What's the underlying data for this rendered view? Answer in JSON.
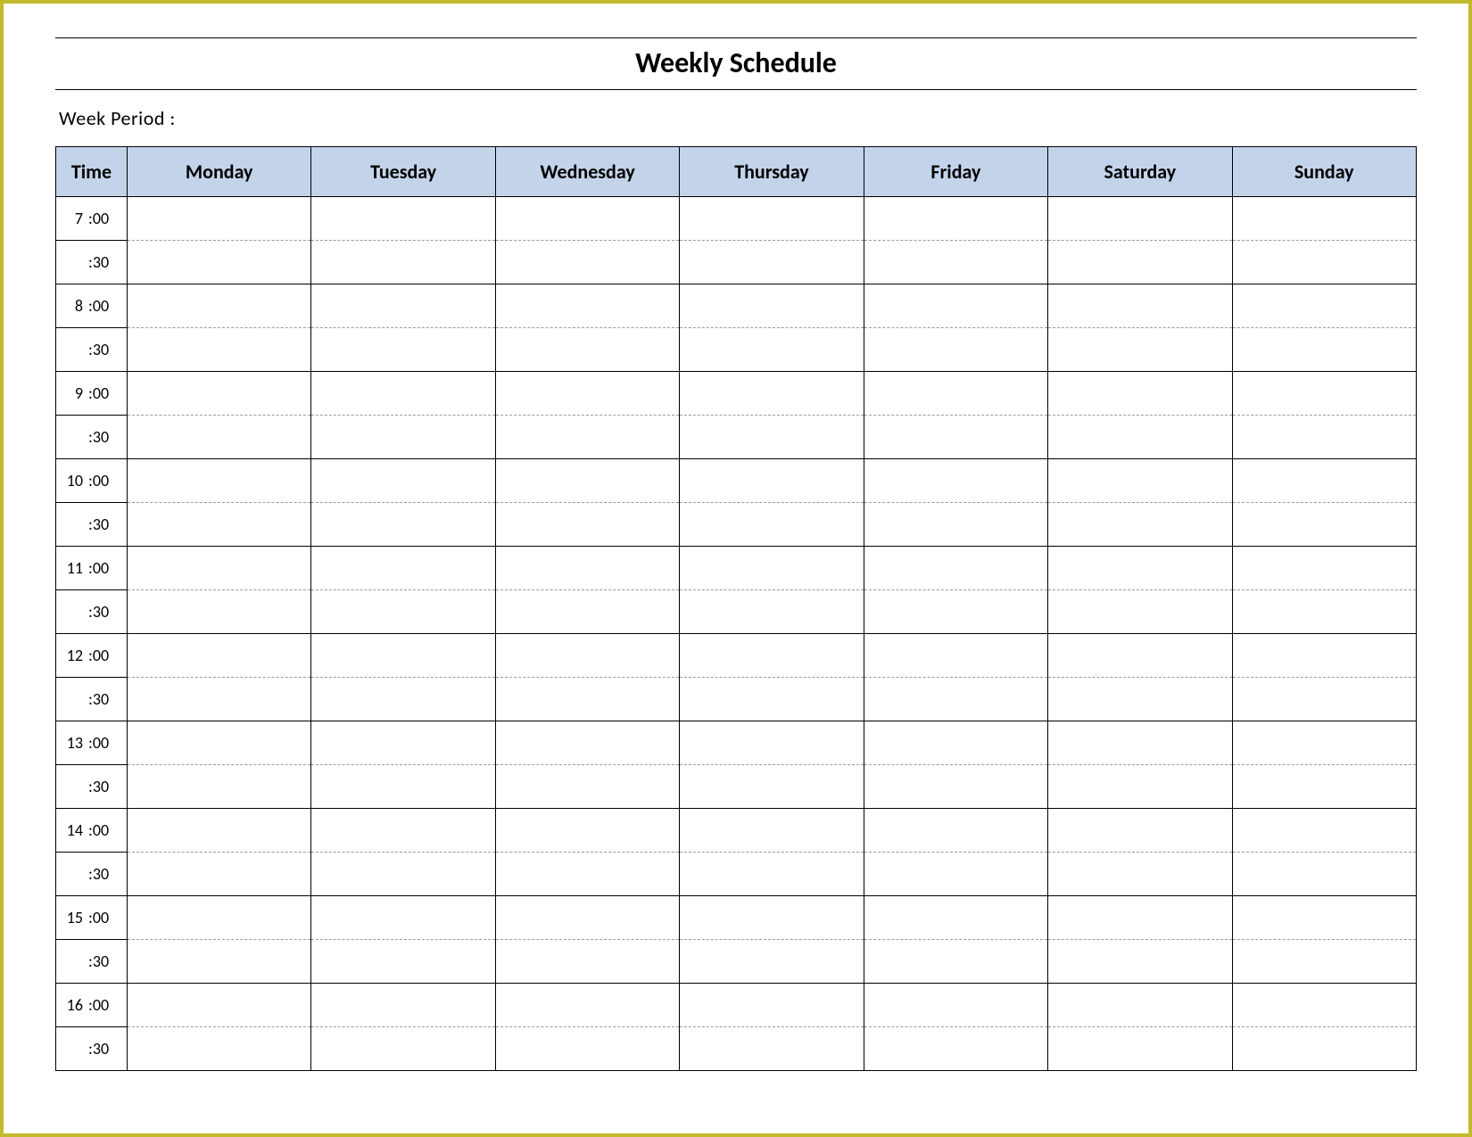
{
  "title": "Weekly Schedule",
  "week_period_label": "Week  Period :",
  "headers": [
    "Time",
    "Monday",
    "Tuesday",
    "Wednesday",
    "Thursday",
    "Friday",
    "Saturday",
    "Sunday"
  ],
  "time_rows": [
    {
      "hour": "7",
      "minute": ":00"
    },
    {
      "hour": "",
      "minute": ":30"
    },
    {
      "hour": "8",
      "minute": ":00"
    },
    {
      "hour": "",
      "minute": ":30"
    },
    {
      "hour": "9",
      "minute": ":00"
    },
    {
      "hour": "",
      "minute": ":30"
    },
    {
      "hour": "10",
      "minute": ":00"
    },
    {
      "hour": "",
      "minute": ":30"
    },
    {
      "hour": "11",
      "minute": ":00"
    },
    {
      "hour": "",
      "minute": ":30"
    },
    {
      "hour": "12",
      "minute": ":00"
    },
    {
      "hour": "",
      "minute": ":30"
    },
    {
      "hour": "13",
      "minute": ":00"
    },
    {
      "hour": "",
      "minute": ":30"
    },
    {
      "hour": "14",
      "minute": ":00"
    },
    {
      "hour": "",
      "minute": ":30"
    },
    {
      "hour": "15",
      "minute": ":00"
    },
    {
      "hour": "",
      "minute": ":30"
    },
    {
      "hour": "16",
      "minute": ":00"
    },
    {
      "hour": "",
      "minute": ":30"
    }
  ]
}
